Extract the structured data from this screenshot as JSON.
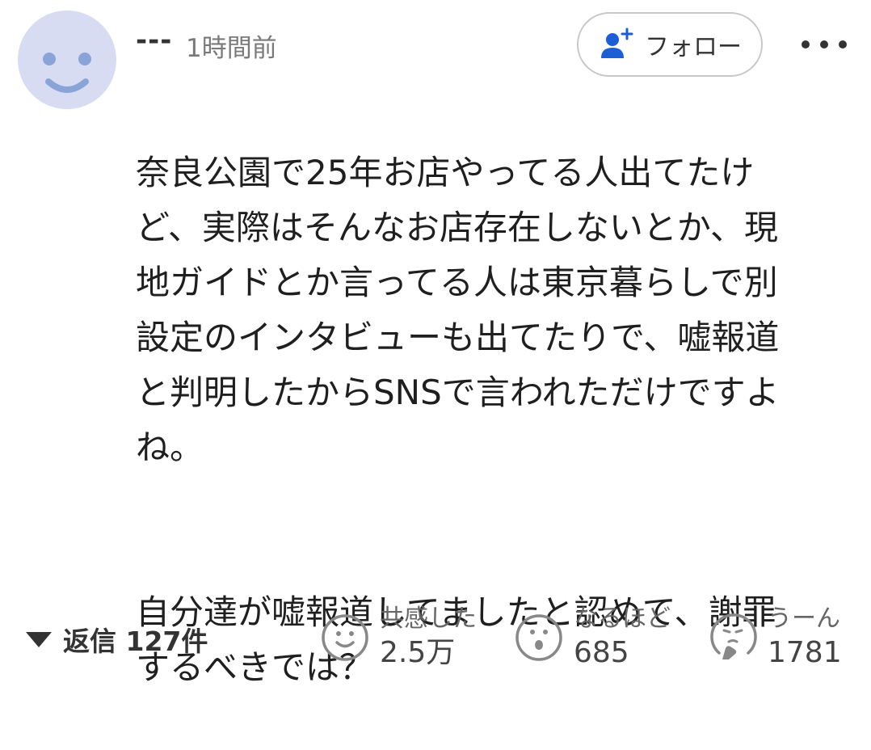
{
  "comment": {
    "username": "---",
    "timestamp": "1時間前",
    "follow_label": "フォロー",
    "body_paragraph_1": "奈良公園で25年お店やってる人出てたけ\nど、実際はそんなお店存在しないとか、現\n地ガイドとか言ってる人は東京暮らしで別\n設定のインタビューも出てたりで、嘘報道\nと判明したからSNSで言われただけですよ\nね。",
    "body_paragraph_2": "自分達が嘘報道してましたと認めて、謝罪\nするべきでは？"
  },
  "footer": {
    "replies_label": "返信 127件",
    "reactions": [
      {
        "label": "共感した",
        "count": "2.5万",
        "icon": "smile-face-icon"
      },
      {
        "label": "なるほど",
        "count": "685",
        "icon": "surprised-face-icon"
      },
      {
        "label": "うーん",
        "count": "1781",
        "icon": "thinking-face-icon"
      }
    ]
  },
  "colors": {
    "avatar_bg": "#d7dcf3",
    "avatar_face": "#8aa4d8",
    "follow_icon": "#1a5fd6",
    "text_primary": "#1f1f1f",
    "text_muted": "#7a7a7a"
  }
}
